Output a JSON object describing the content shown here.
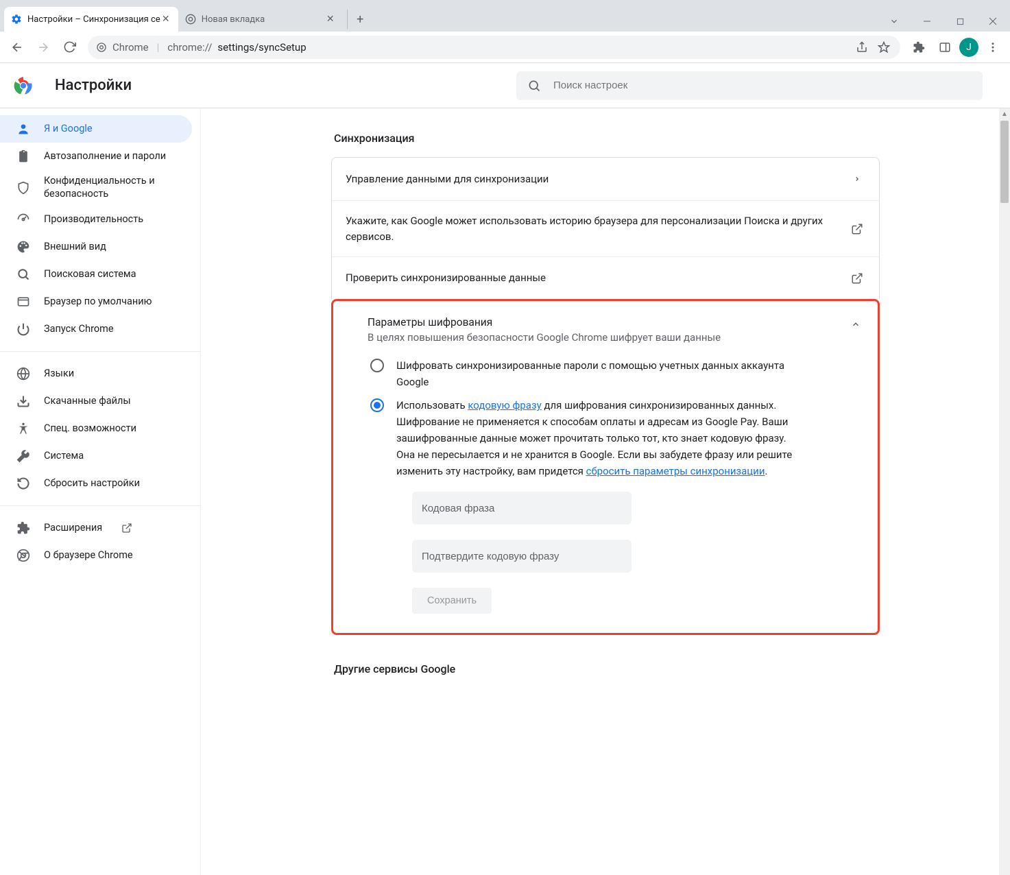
{
  "window": {
    "tabs": [
      {
        "title": "Настройки – Синхронизация се",
        "active": true,
        "favicon": "gear"
      },
      {
        "title": "Новая вкладка",
        "active": false,
        "favicon": "chrome"
      }
    ]
  },
  "omnibox": {
    "scheme_label": "Chrome",
    "url_grey": "chrome://",
    "url_dark": "settings/syncSetup"
  },
  "avatar_letter": "J",
  "header": {
    "title": "Настройки",
    "search_placeholder": "Поиск настроек"
  },
  "sidebar": {
    "groups": [
      [
        {
          "icon": "person",
          "label": "Я и Google",
          "active": true
        },
        {
          "icon": "clipboard",
          "label": "Автозаполнение и пароли"
        },
        {
          "icon": "shield",
          "label": "Конфиденциальность и безопасность",
          "tall": true
        },
        {
          "icon": "speed",
          "label": "Производительность"
        },
        {
          "icon": "palette",
          "label": "Внешний вид"
        },
        {
          "icon": "search",
          "label": "Поисковая система"
        },
        {
          "icon": "browser",
          "label": "Браузер по умолчанию"
        },
        {
          "icon": "power",
          "label": "Запуск Chrome"
        }
      ],
      [
        {
          "icon": "globe",
          "label": "Языки"
        },
        {
          "icon": "download",
          "label": "Скачанные файлы"
        },
        {
          "icon": "accessibility",
          "label": "Спец. возможности"
        },
        {
          "icon": "wrench",
          "label": "Система"
        },
        {
          "icon": "reset",
          "label": "Сбросить настройки"
        }
      ],
      [
        {
          "icon": "extension",
          "label": "Расширения",
          "ext": true
        },
        {
          "icon": "chrome",
          "label": "О браузере Chrome"
        }
      ]
    ]
  },
  "main": {
    "section_title": "Синхронизация",
    "rows": [
      {
        "text": "Управление данными для синхронизации",
        "action": "chevron"
      },
      {
        "text": "Укажите, как Google может использовать историю браузера для персонализации Поиска и других сервисов.",
        "action": "open"
      },
      {
        "text": "Проверить синхронизированные данные",
        "action": "open"
      }
    ],
    "enc": {
      "title": "Параметры шифрования",
      "sub": "В целях повышения безопасности Google Chrome шифрует ваши данные",
      "chevron": "up",
      "option1": "Шифровать синхронизированные пароли с помощью учетных данных аккаунта Google",
      "option2_pre": "Использовать ",
      "option2_link1": "кодовую фразу",
      "option2_mid": " для шифрования синхронизированных данных. Шифрование не применяется к способам оплаты и адресам из Google Pay. Ваши зашифрованные данные может прочитать только тот, кто знает кодовую фразу. Она не пересылается и не хранится в Google. Если вы забудете фразу или решите изменить эту настройку, вам придется ",
      "option2_link2": "сбросить параметры синхронизации",
      "option2_post": ".",
      "pass_ph": "Кодовая фраза",
      "confirm_ph": "Подтвердите кодовую фразу",
      "save": "Сохранить"
    },
    "section2_title": "Другие сервисы Google"
  }
}
